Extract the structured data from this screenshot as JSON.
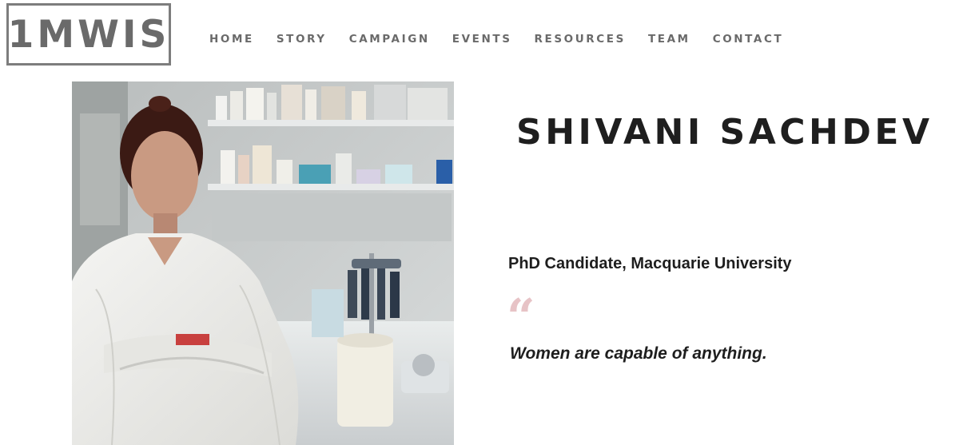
{
  "header": {
    "logo_text": "1MWIS",
    "nav": [
      {
        "label": "HOME"
      },
      {
        "label": "STORY"
      },
      {
        "label": "CAMPAIGN"
      },
      {
        "label": "EVENTS"
      },
      {
        "label": "RESOURCES"
      },
      {
        "label": "TEAM"
      },
      {
        "label": "CONTACT"
      }
    ]
  },
  "profile": {
    "name": "SHIVANI SACHDEV",
    "role": "PhD Candidate, Macquarie University",
    "quote_mark": "“",
    "quote": "Women are capable of anything."
  },
  "colors": {
    "nav_text": "#6a6a6a",
    "heading_text": "#1e1e1e",
    "quote_mark": "#e7c3c6",
    "logo_border": "#7d7d7d"
  }
}
